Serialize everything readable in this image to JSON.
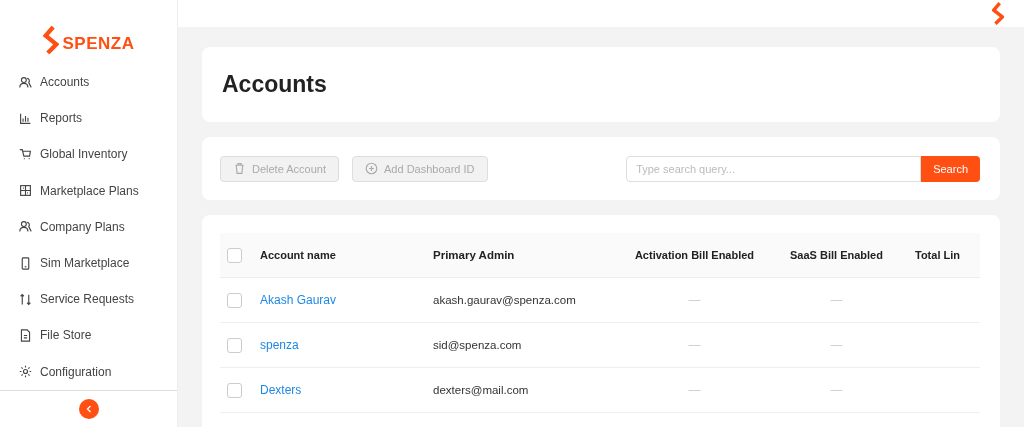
{
  "brand": {
    "name": "SPENZA"
  },
  "sidebar": {
    "items": [
      {
        "label": "Accounts",
        "kind": "people"
      },
      {
        "label": "Reports",
        "kind": "chart"
      },
      {
        "label": "Global Inventory",
        "kind": "cart"
      },
      {
        "label": "Marketplace Plans",
        "kind": "grid"
      },
      {
        "label": "Company Plans",
        "kind": "people"
      },
      {
        "label": "Sim Marketplace",
        "kind": "phone"
      },
      {
        "label": "Service Requests",
        "kind": "swap"
      },
      {
        "label": "File Store",
        "kind": "file"
      },
      {
        "label": "Configuration",
        "kind": "gear"
      }
    ]
  },
  "page": {
    "title": "Accounts"
  },
  "toolbar": {
    "buttons": [
      {
        "label": "Delete Account",
        "kind": "trash",
        "disabled": true
      },
      {
        "label": "Add Dashboard ID",
        "kind": "plus",
        "disabled": true
      }
    ],
    "search": {
      "placeholder": "Type search query...",
      "button": "Search"
    }
  },
  "table": {
    "header_checked": false,
    "columns": [
      "Account name",
      "Primary Admin",
      "Activation Bill Enabled",
      "SaaS Bill Enabled",
      "Total Lin"
    ],
    "rows": [
      {
        "checked": false,
        "name": "Akash Gaurav",
        "admin": "akash.gaurav@spenza.com",
        "activation": "—",
        "saas": "—"
      },
      {
        "checked": false,
        "name": "spenza",
        "admin": "sid@spenza.com",
        "activation": "—",
        "saas": "—"
      },
      {
        "checked": false,
        "name": "Dexters",
        "admin": "dexters@mail.com",
        "activation": "—",
        "saas": "—"
      }
    ]
  }
}
